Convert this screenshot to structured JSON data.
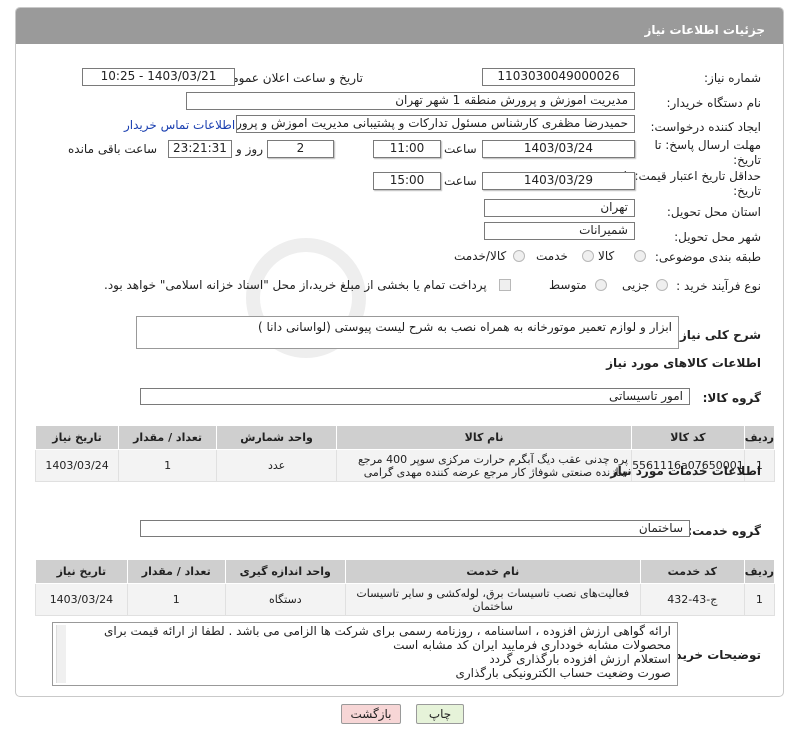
{
  "header": {
    "title": "جزئیات اطلاعات نیاز"
  },
  "labels": {
    "need_number": "شماره نیاز:",
    "announce_datetime": "تاریخ و ساعت اعلان عمومی:",
    "buyer_org": "نام دستگاه خریدار:",
    "requester": "ایجاد کننده درخواست:",
    "reply_deadline_1": "مهلت ارسال پاسخ: تا",
    "reply_deadline_2": "تاریخ:",
    "time": "ساعت",
    "day_and": "روز و",
    "remaining": "ساعت باقی مانده",
    "price_validity_1": "حداقل تاریخ اعتبار قیمت: تا",
    "price_validity_2": "تاریخ:",
    "delivery_province": "استان محل تحویل:",
    "delivery_city": "شهر محل تحویل:",
    "category": "طبقه بندی موضوعی:",
    "purchase_type": "نوع فرآیند خرید :",
    "general_desc": "شرح کلی نیاز:",
    "goods_info": "اطلاعات کالاهای مورد نیاز",
    "goods_group": "گروه کالا:",
    "services_info": "اطلاعات خدمات مورد نیاز",
    "service_group": "گروه خدمت:",
    "buyer_notes": "توضیحات خریدار:"
  },
  "values": {
    "need_number": "1103030049000026",
    "announce_datetime": "1403/03/21 - 10:25",
    "buyer_org": "مدیریت اموزش و پرورش منطقه 1 شهر تهران",
    "requester": "حمیدرضا مظفری کارشناس مسئول تدارکات و پشتیبانی مدیریت اموزش و پرورش",
    "contact_link": "اطلاعات تماس خریدار",
    "reply_date": "1403/03/24",
    "reply_time": "11:00",
    "reply_days": "2",
    "reply_remaining": "23:21:31",
    "price_date": "1403/03/29",
    "price_time": "15:00",
    "province": "تهران",
    "city": "شمیرانات",
    "general_desc": "ابزار و لوازم تعمیر موتورخانه به همراه نصب به شرح لیست پیوستی (لواسانی دانا )",
    "goods_group": "امور تاسیساتی",
    "service_group": "ساختمان"
  },
  "category_options": [
    "کالا",
    "خدمت",
    "کالا/خدمت"
  ],
  "purchase_options": [
    "جزیی",
    "متوسط"
  ],
  "payment_note": "پرداخت تمام یا بخشی از مبلغ خرید،از محل \"اسناد خزانه اسلامی\" خواهد بود.",
  "goods_table": {
    "headers": [
      "ردیف",
      "کد کالا",
      "نام کالا",
      "واحد شمارش",
      "تعداد / مقدار",
      "تاریخ نیاز"
    ],
    "rows": [
      [
        "1",
        "5561116a07650001",
        "پره چدنی عقب دیگ آبگرم حرارت مرکزی سوپر 400 مرجع سازنده صنعتی شوفاژ کار مرجع عرضه کننده مهدی گرامی",
        "عدد",
        "1",
        "1403/03/24"
      ]
    ]
  },
  "services_table": {
    "headers": [
      "ردیف",
      "کد خدمت",
      "نام خدمت",
      "واحد اندازه گیری",
      "تعداد / مقدار",
      "تاریخ نیاز"
    ],
    "rows": [
      [
        "1",
        "ج-43-432",
        "فعالیت‌های نصب تاسیسات برق، لوله‌کشی و سایر تاسیسات ساختمان",
        "دستگاه",
        "1",
        "1403/03/24"
      ]
    ]
  },
  "buyer_notes": [
    "ارائه گواهی ارزش افزوده ، اساسنامه ، روزنامه رسمی برای شرکت ها الزامی می باشد . لطفا از ارائه قیمت برای",
    "محصولات مشابه خودداری فرمایید ایران کد مشابه است",
    "استعلام ارزش افزوده بارگذاری گردد",
    "صورت وضعیت حساب الکترونیکی بارگذاری"
  ],
  "buttons": {
    "print": "چاپ",
    "back": "بازگشت"
  },
  "colors": {
    "header": "#9a9a9a",
    "back_button": "#f7d6d6",
    "print_button": "#e6f3d9",
    "link": "#1a3fb0"
  }
}
